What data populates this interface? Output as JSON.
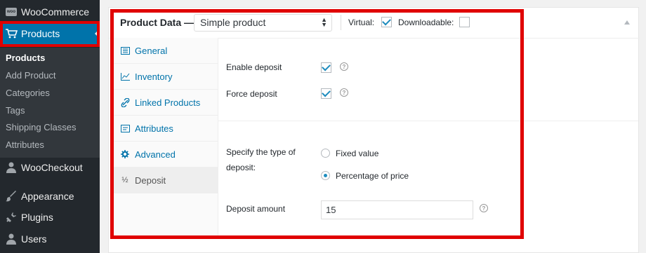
{
  "sidebar": {
    "woocommerce": {
      "label": "WooCommerce",
      "badge": "woo"
    },
    "products": {
      "label": "Products"
    },
    "submenu": [
      "Products",
      "Add Product",
      "Categories",
      "Tags",
      "Shipping Classes",
      "Attributes"
    ],
    "woocheckout": {
      "label": "WooCheckout"
    },
    "appearance": {
      "label": "Appearance"
    },
    "plugins": {
      "label": "Plugins"
    },
    "users": {
      "label": "Users"
    }
  },
  "product_data": {
    "title": "Product Data —",
    "product_type": "Simple product",
    "virtual_label": "Virtual:",
    "virtual_checked": true,
    "downloadable_label": "Downloadable:",
    "downloadable_checked": false
  },
  "tabs": [
    {
      "label": "General",
      "icon": "general-icon"
    },
    {
      "label": "Inventory",
      "icon": "inventory-icon"
    },
    {
      "label": "Linked Products",
      "icon": "link-icon"
    },
    {
      "label": "Attributes",
      "icon": "attributes-icon"
    },
    {
      "label": "Advanced",
      "icon": "gear-icon"
    },
    {
      "label": "Deposit",
      "icon": "half-icon",
      "glyph": "½",
      "selected": true
    }
  ],
  "deposit": {
    "enable_label": "Enable deposit",
    "enable_checked": true,
    "force_label": "Force deposit",
    "force_checked": true,
    "type_label_line1": "Specify the type of",
    "type_label_line2": "deposit:",
    "options": [
      "Fixed value",
      "Percentage of price"
    ],
    "selected_option": "Percentage of price",
    "amount_label": "Deposit amount",
    "amount_value": "15"
  },
  "colors": {
    "accent": "#0073aa",
    "highlight": "#e00000",
    "sidebar": "#23282d"
  }
}
